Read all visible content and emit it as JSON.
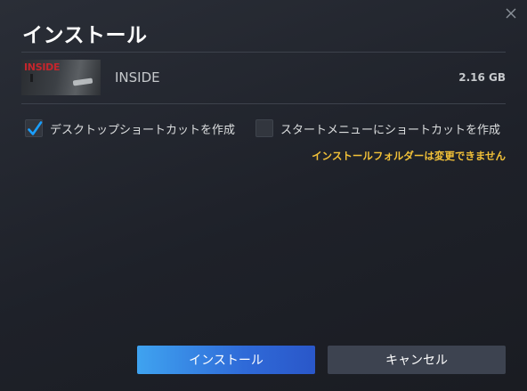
{
  "dialog": {
    "title": "インストール",
    "close_icon": "close-icon"
  },
  "game": {
    "thumbnail_logo": "INSIDE",
    "name": "INSIDE",
    "size": "2.16 GB"
  },
  "options": {
    "desktop_shortcut": {
      "label": "デスクトップショートカットを作成",
      "checked": true
    },
    "start_menu_shortcut": {
      "label": "スタートメニューにショートカットを作成",
      "checked": false
    },
    "install_folder_warning": "インストールフォルダーは変更できません"
  },
  "buttons": {
    "install_label": "インストール",
    "cancel_label": "キャンセル"
  },
  "colors": {
    "accent_blue": "#2f6ad8",
    "warning_yellow": "#f2c138",
    "checkmark_blue": "#1a9fff",
    "background": "#1e2129"
  }
}
